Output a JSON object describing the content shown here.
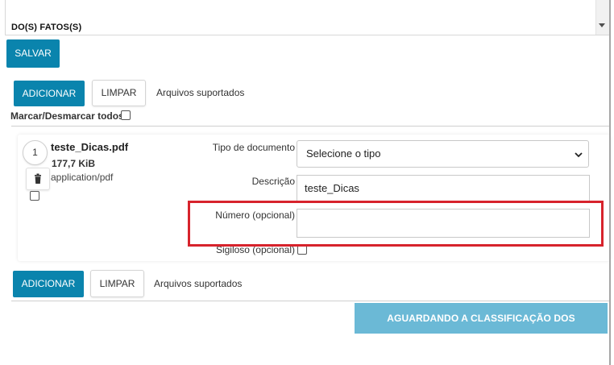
{
  "top_area": {
    "text": "DO(S) FATOS(S)"
  },
  "salvar_label": "SALVAR",
  "upload_toolbar_top": {
    "add_label": "ADICIONAR",
    "clear_label": "LIMPAR",
    "supported_label": "Arquivos suportados"
  },
  "select_all_label": "Marcar/Desmarcar todos",
  "file": {
    "index": "1",
    "name": "teste_Dicas.pdf",
    "size": "177,7 KiB",
    "mime": "application/pdf",
    "tipo_label": "Tipo de documento",
    "tipo_value": "Selecione o tipo",
    "desc_label": "Descrição",
    "desc_value": "teste_Dicas",
    "numero_label": "Número (opcional)",
    "numero_value": "",
    "sigiloso_label": "Sigiloso (opcional)"
  },
  "upload_toolbar_bottom": {
    "add_label": "ADICIONAR",
    "clear_label": "LIMPAR",
    "supported_label": "Arquivos suportados"
  },
  "status_button_label": "AGUARDANDO A CLASSIFICAÇÃO DOS DOCUMENTOS",
  "colors": {
    "primary": "#0a84ad",
    "disabled_primary": "#6bb9d6",
    "highlight": "#d7232c"
  },
  "icons": {
    "trash": "trash-icon",
    "dropdown": "chevron-down-icon",
    "scroll": "scroll-down-arrow-icon"
  }
}
